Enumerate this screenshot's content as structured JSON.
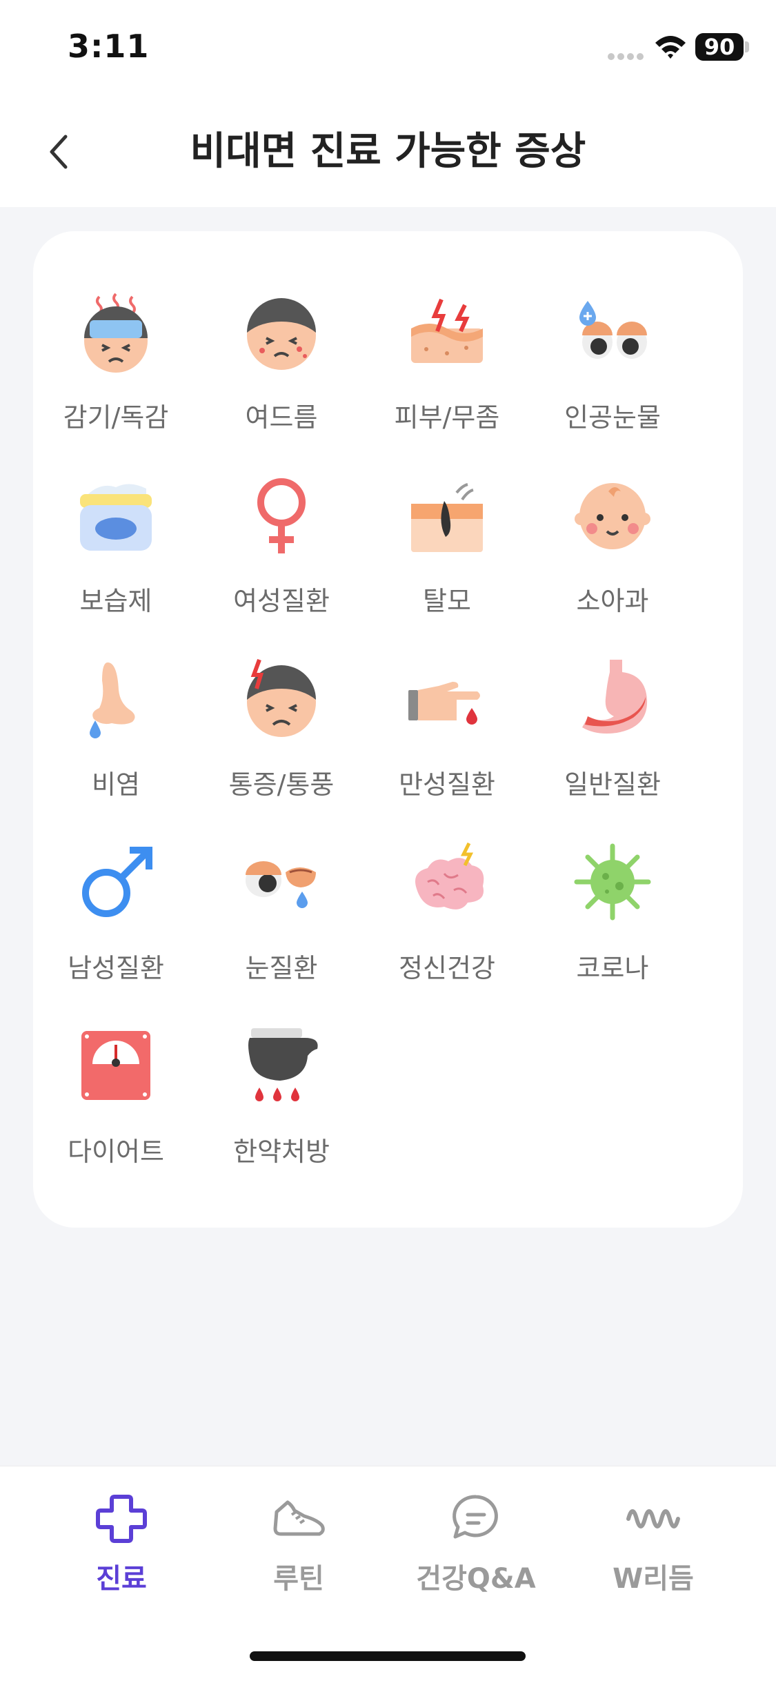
{
  "status_bar": {
    "time": "3:11",
    "battery": "90"
  },
  "header": {
    "title": "비대면 진료 가능한 증상"
  },
  "symptoms": [
    {
      "label": "감기/독감",
      "icon": "cold-fever-face-icon"
    },
    {
      "label": "여드름",
      "icon": "acne-face-icon"
    },
    {
      "label": "피부/무좀",
      "icon": "skin-icon"
    },
    {
      "label": "인공눈물",
      "icon": "eye-drop-icon"
    },
    {
      "label": "보습제",
      "icon": "moisturizer-jar-icon"
    },
    {
      "label": "여성질환",
      "icon": "female-symbol-icon"
    },
    {
      "label": "탈모",
      "icon": "hair-loss-icon"
    },
    {
      "label": "소아과",
      "icon": "baby-face-icon"
    },
    {
      "label": "비염",
      "icon": "runny-nose-icon"
    },
    {
      "label": "통증/통풍",
      "icon": "pain-face-icon"
    },
    {
      "label": "만성질환",
      "icon": "finger-blood-test-icon"
    },
    {
      "label": "일반질환",
      "icon": "stomach-icon"
    },
    {
      "label": "남성질환",
      "icon": "male-symbol-icon"
    },
    {
      "label": "눈질환",
      "icon": "eye-disease-icon"
    },
    {
      "label": "정신건강",
      "icon": "brain-icon"
    },
    {
      "label": "코로나",
      "icon": "virus-icon"
    },
    {
      "label": "다이어트",
      "icon": "scale-icon"
    },
    {
      "label": "한약처방",
      "icon": "herbal-medicine-pot-icon"
    }
  ],
  "bottom_nav": {
    "tabs": [
      {
        "label": "진료",
        "icon": "medical-cross-icon",
        "active": true
      },
      {
        "label": "루틴",
        "icon": "sneaker-icon",
        "active": false
      },
      {
        "label": "건강Q&A",
        "icon": "chat-bubble-icon",
        "active": false
      },
      {
        "label": "W리듬",
        "icon": "wave-icon",
        "active": false
      }
    ]
  },
  "colors": {
    "accent": "#5b3fd6",
    "inactive": "#9a9a9a",
    "label": "#6b6b6b"
  }
}
